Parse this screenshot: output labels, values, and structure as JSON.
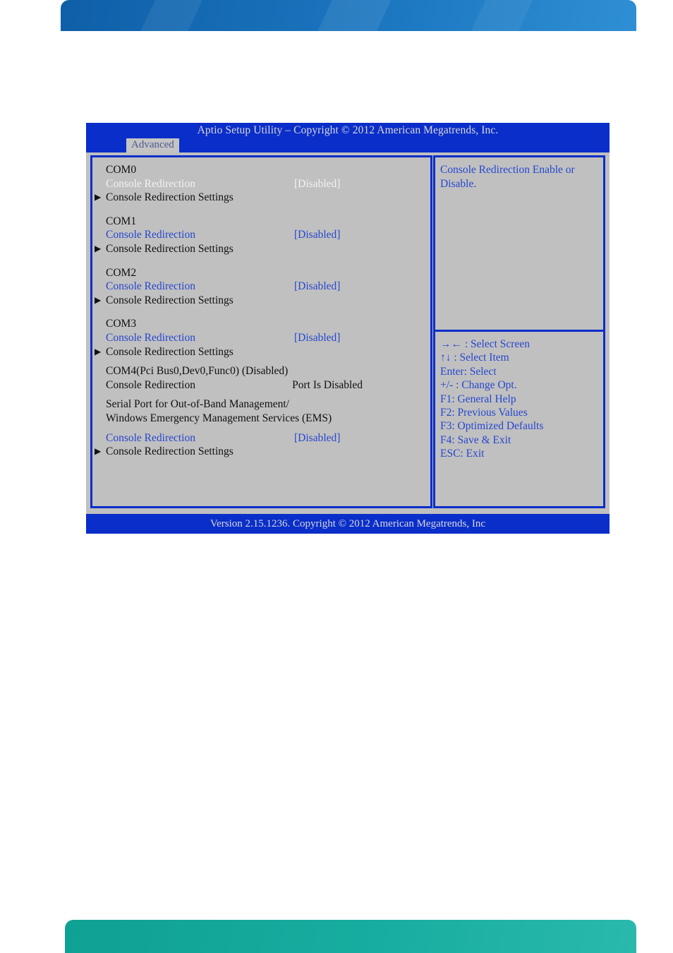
{
  "banners": {
    "top_color": "#1b76bf",
    "bottom_color": "#17ada0"
  },
  "bios": {
    "title": "Aptio Setup Utility  –  Copyright © 2012 American Megatrends, Inc.",
    "active_tab": "Advanced",
    "footer": "Version 2.15.1236. Copyright © 2012 American Megatrends, Inc",
    "colors": {
      "titlebar_blue": "#0a2ec9",
      "panel_gray": "#c0c0c0",
      "link_blue": "#2647cf",
      "selected_text": "#f2f2f2"
    },
    "groups": [
      {
        "header": "COM0",
        "rows": [
          {
            "arrow": "",
            "label": "Console Redirection",
            "value": "[Disabled]",
            "style": "selected"
          },
          {
            "arrow": "▶",
            "label": "Console Redirection Settings",
            "value": "",
            "style": "normal"
          }
        ]
      },
      {
        "header": "COM1",
        "rows": [
          {
            "arrow": "",
            "label": "Console Redirection",
            "value": "[Disabled]",
            "style": "blue"
          },
          {
            "arrow": "▶",
            "label": "Console Redirection Settings",
            "value": "",
            "style": "normal"
          }
        ]
      },
      {
        "header": "COM2",
        "rows": [
          {
            "arrow": "",
            "label": "Console Redirection",
            "value": "[Disabled]",
            "style": "blue"
          },
          {
            "arrow": "▶",
            "label": "Console Redirection Settings",
            "value": "",
            "style": "normal"
          }
        ]
      },
      {
        "header": "COM3",
        "rows": [
          {
            "arrow": "",
            "label": "Console Redirection",
            "value": "[Disabled]",
            "style": "blue"
          },
          {
            "arrow": "▶",
            "label": "Console Redirection Settings",
            "value": "",
            "style": "normal"
          }
        ]
      },
      {
        "header": "COM4(Pci Bus0,Dev0,Func0)  (Disabled)",
        "rows": [
          {
            "arrow": "",
            "label": "Console Redirection",
            "value": "Port Is Disabled",
            "style": "normal"
          }
        ]
      },
      {
        "header": "Serial Port for Out-of-Band Management/",
        "header2": "Windows Emergency Management Services (EMS)",
        "rows": [
          {
            "arrow": "",
            "label": "Console Redirection",
            "value": "[Disabled]",
            "style": "blue"
          },
          {
            "arrow": "▶",
            "label": "Console Redirection Settings",
            "value": "",
            "style": "normal"
          }
        ]
      }
    ],
    "help": {
      "line1": "Console Redirection Enable or",
      "line2": "Disable."
    },
    "keys": [
      "→← : Select Screen",
      "↑↓ : Select Item",
      "Enter: Select",
      "+/- : Change Opt.",
      "F1: General Help",
      "F2: Previous Values",
      "F3: Optimized Defaults",
      "F4: Save & Exit",
      "ESC: Exit"
    ]
  }
}
